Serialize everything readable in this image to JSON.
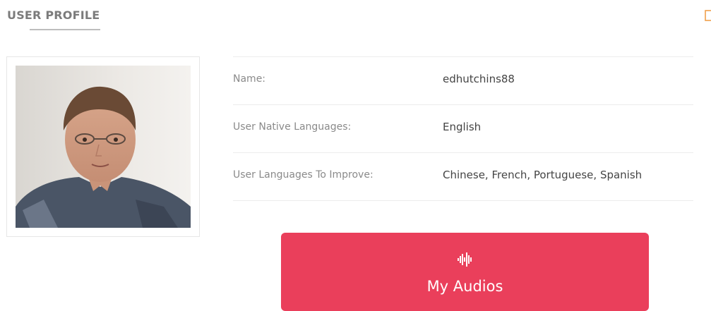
{
  "header": {
    "title": "USER PROFILE",
    "edit_icon": "edit-icon"
  },
  "profile": {
    "photo_alt": "user-photo",
    "fields": [
      {
        "label": "Name:",
        "value": "edhutchins88"
      },
      {
        "label": "User Native Languages:",
        "value": "English"
      },
      {
        "label": "User Languages To Improve:",
        "value": "Chinese, French, Portuguese, Spanish"
      }
    ]
  },
  "audios_button": {
    "label": "My Audios",
    "icon": "sound-wave-icon",
    "color": "#ea3f5b"
  },
  "colors": {
    "accent": "#ea3f5b",
    "edit_icon": "#f0a04b",
    "label_text": "#8a8a8a",
    "value_text": "#444444"
  }
}
